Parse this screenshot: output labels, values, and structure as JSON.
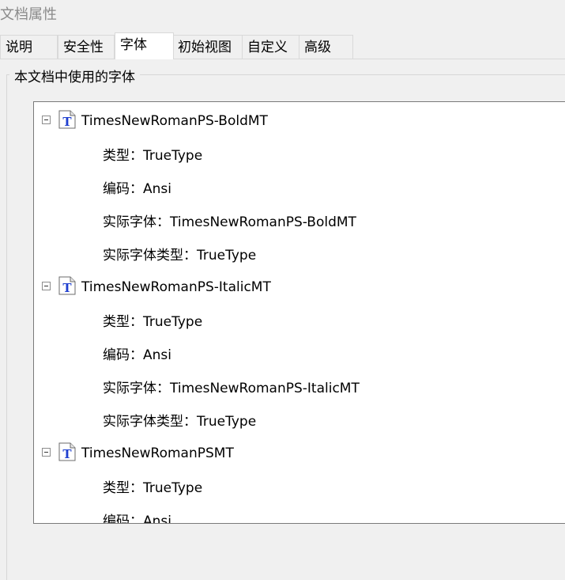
{
  "window": {
    "title": "文档属性"
  },
  "tabs": [
    {
      "label": "说明"
    },
    {
      "label": "安全性"
    },
    {
      "label": "字体"
    },
    {
      "label": "初始视图"
    },
    {
      "label": "自定义"
    },
    {
      "label": "高级"
    }
  ],
  "active_tab": "字体",
  "fonts_group": {
    "label": "本文档中使用的字体",
    "fonts": [
      {
        "name": "TimesNewRomanPS-BoldMT",
        "type": "类型：TrueType",
        "encoding": "编码：Ansi",
        "actual_font": "实际字体：TimesNewRomanPS-BoldMT",
        "actual_font_type": "实际字体类型：TrueType"
      },
      {
        "name": "TimesNewRomanPS-ItalicMT",
        "type": "类型：TrueType",
        "encoding": "编码：Ansi",
        "actual_font": "实际字体：TimesNewRomanPS-ItalicMT",
        "actual_font_type": "实际字体类型：TrueType"
      },
      {
        "name": "TimesNewRomanPSMT",
        "type": "类型：TrueType",
        "encoding": "编码：Ansi"
      }
    ]
  },
  "icons": {
    "expander": "collapse-minus-icon",
    "font": "truetype-font-icon"
  },
  "colors": {
    "background": "#f0f0f0",
    "list_background": "#ffffff",
    "font_icon_blue": "#1f3fcf",
    "title_gray": "#8a8a8a"
  }
}
